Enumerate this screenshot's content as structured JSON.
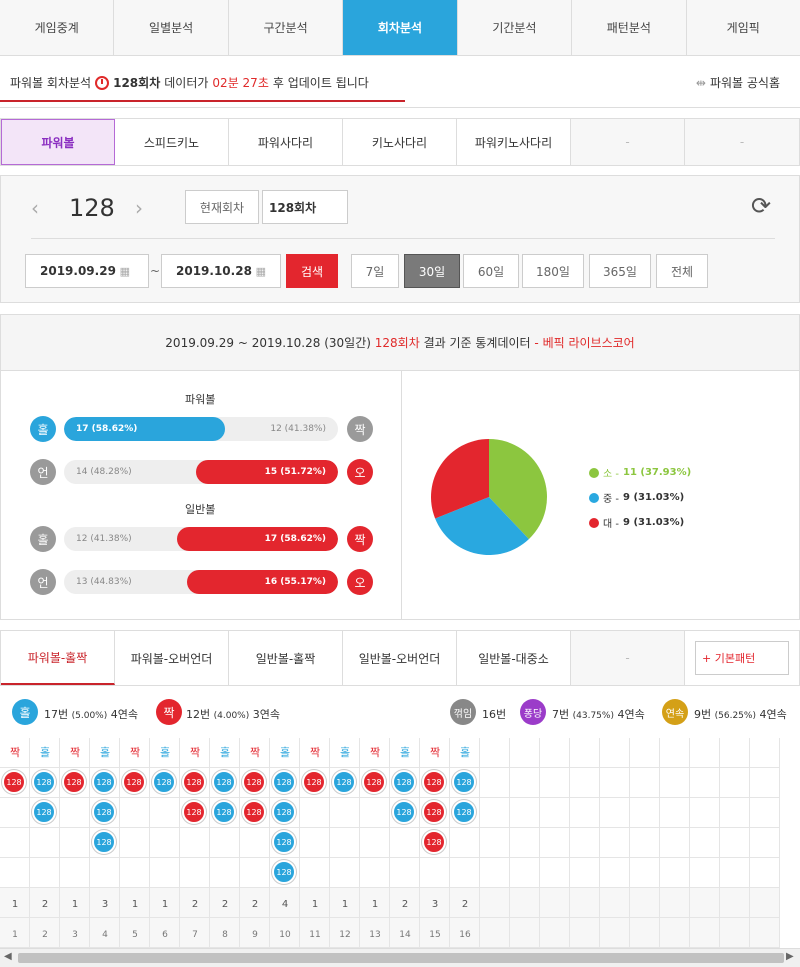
{
  "top_tabs": [
    "게임중계",
    "일별분석",
    "구간분석",
    "회차분석",
    "기간분석",
    "패턴분석",
    "게임픽"
  ],
  "info": {
    "prefix": "파워볼 회차분석",
    "round": "128회차",
    "mid": "데이터가",
    "time": "02분 27초",
    "suffix": "후 업데이트 됩니다",
    "link": "파워볼 공식홈"
  },
  "game_tabs": [
    "파워볼",
    "스피드키노",
    "파워사다리",
    "키노사다리",
    "파워키노사다리",
    "-",
    "-"
  ],
  "search": {
    "round_number": "128",
    "current_label": "현재회차",
    "round_value": "128회차",
    "date_from": "2019.09.29",
    "tilde": "~",
    "date_to": "2019.10.28",
    "search_label": "검색",
    "periods": [
      "7일",
      "30일",
      "60일",
      "180일",
      "365일",
      "전체"
    ]
  },
  "stats": {
    "header_range": "2019.09.29 ~ 2019.10.28 (30일간)",
    "header_round": "128회차",
    "header_mid": "결과 기준 통계데이터",
    "header_source": "- 베픽 라이브스코어",
    "powerball_title": "파워볼",
    "normal_title": "일반볼",
    "pb_odd": {
      "left_label": "홀",
      "left_text": "17 (58.62%)",
      "right_text": "12 (41.38%)",
      "right_label": "짝",
      "ratio": 0.5862
    },
    "pb_under": {
      "left_label": "언",
      "left_text": "14 (48.28%)",
      "right_text": "15 (51.72%)",
      "right_label": "오",
      "ratio": 0.4828
    },
    "nb_odd": {
      "left_label": "홀",
      "left_text": "12 (41.38%)",
      "right_text": "17 (58.62%)",
      "right_label": "짝",
      "ratio": 0.4138
    },
    "nb_under": {
      "left_label": "언",
      "left_text": "13 (44.83%)",
      "right_text": "16 (55.17%)",
      "right_label": "오",
      "ratio": 0.4483
    },
    "pie": [
      {
        "label": "소",
        "value": 11,
        "text": "11 (37.93%)",
        "color": "#8cc63f"
      },
      {
        "label": "중",
        "value": 9,
        "text": "9 (31.03%)",
        "color": "#29a8e0"
      },
      {
        "label": "대",
        "value": 9,
        "text": "9 (31.03%)",
        "color": "#e3262e"
      }
    ]
  },
  "pattern_tabs": [
    "파워볼-홀짝",
    "파워볼-오버언더",
    "일반볼-홀짝",
    "일반볼-오버언더",
    "일반볼-대중소",
    "-"
  ],
  "pattern_button": "+ 기본패턴",
  "summary": {
    "odd_label": "홀",
    "odd_text": "17번",
    "odd_pct": "(5.00%)",
    "odd_streak": "4연속",
    "even_label": "짝",
    "even_text": "12번",
    "even_pct": "(4.00%)",
    "even_streak": "3연속",
    "break_label": "꺾임",
    "break_text": "16번",
    "bounce_label": "퐁당",
    "bounce_text": "7번",
    "bounce_pct": "(43.75%)",
    "bounce_streak": "4연속",
    "cont_label": "연속",
    "cont_text": "9번",
    "cont_pct": "(56.25%)",
    "cont_streak": "4연속"
  },
  "pattern": {
    "ball_label": "128",
    "columns": [
      {
        "h": "짝",
        "n": 1
      },
      {
        "h": "홀",
        "n": 2
      },
      {
        "h": "짝",
        "n": 1
      },
      {
        "h": "홀",
        "n": 3
      },
      {
        "h": "짝",
        "n": 1
      },
      {
        "h": "홀",
        "n": 1
      },
      {
        "h": "짝",
        "n": 2
      },
      {
        "h": "홀",
        "n": 2
      },
      {
        "h": "짝",
        "n": 2
      },
      {
        "h": "홀",
        "n": 4
      },
      {
        "h": "짝",
        "n": 1
      },
      {
        "h": "홀",
        "n": 1
      },
      {
        "h": "짝",
        "n": 1
      },
      {
        "h": "홀",
        "n": 2
      },
      {
        "h": "짝",
        "n": 3
      },
      {
        "h": "홀",
        "n": 2
      }
    ],
    "index": [
      "1",
      "2",
      "3",
      "4",
      "5",
      "6",
      "7",
      "8",
      "9",
      "10",
      "11",
      "12",
      "13",
      "14",
      "15",
      "16"
    ]
  },
  "colors": {
    "blue": "#2aa5dc",
    "red": "#e3262e",
    "gray": "#9a9a9a",
    "green": "#8cc63f",
    "purple": "#8a2ec1",
    "gold": "#d4a017"
  }
}
